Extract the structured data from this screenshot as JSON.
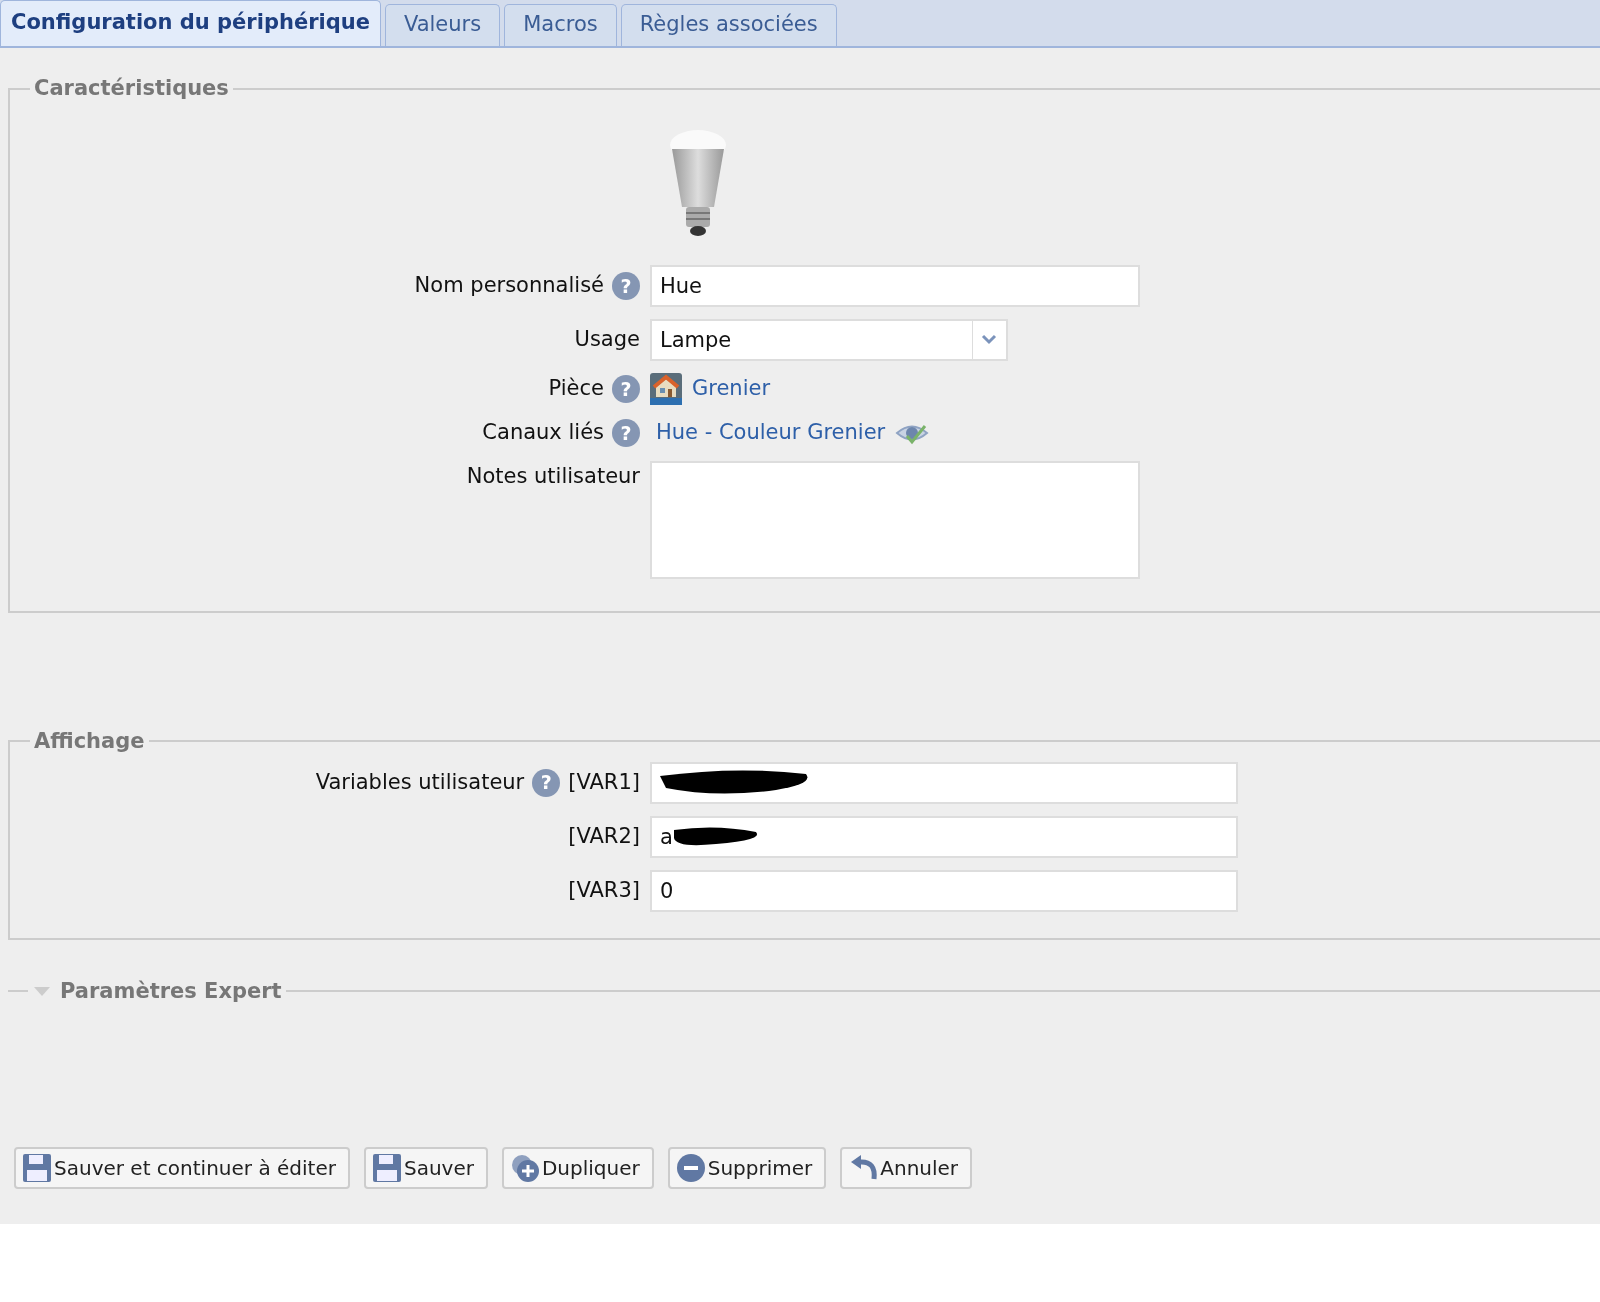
{
  "tabs": [
    {
      "label": "Configuration du périphérique",
      "selected": true
    },
    {
      "label": "Valeurs",
      "selected": false
    },
    {
      "label": "Macros",
      "selected": false
    },
    {
      "label": "Règles associées",
      "selected": false
    }
  ],
  "characteristics": {
    "legend": "Caractéristiques",
    "fields": [
      {
        "kind": "text",
        "label": "Nom personnalisé",
        "help": "?",
        "value": "Hue"
      },
      {
        "kind": "select",
        "label": "Usage",
        "value": "Lampe"
      },
      {
        "kind": "room",
        "label": "Pièce",
        "help": "?",
        "link": "Grenier"
      },
      {
        "kind": "channel",
        "label": "Canaux liés",
        "help": "?",
        "link": "Hue - Couleur Grenier"
      },
      {
        "kind": "textarea",
        "label": "Notes utilisateur"
      }
    ]
  },
  "display": {
    "legend": "Affichage",
    "label": "Variables utilisateur",
    "help": "?",
    "variables": [
      {
        "name": "[VAR1]",
        "redacted": true
      },
      {
        "name": "[VAR2]",
        "value": "a",
        "redacted": true
      },
      {
        "name": "[VAR3]",
        "value": "0",
        "redacted": false
      }
    ]
  },
  "expert": {
    "legend": "Paramètres Expert",
    "expanded": false
  },
  "buttons": [
    {
      "kind": "save",
      "label": "Sauver et continuer à éditer"
    },
    {
      "kind": "save",
      "label": "Sauver"
    },
    {
      "kind": "duplicate",
      "label": "Dupliquer"
    },
    {
      "kind": "delete",
      "label": "Supprimer"
    },
    {
      "kind": "undo",
      "label": "Annuler"
    }
  ]
}
